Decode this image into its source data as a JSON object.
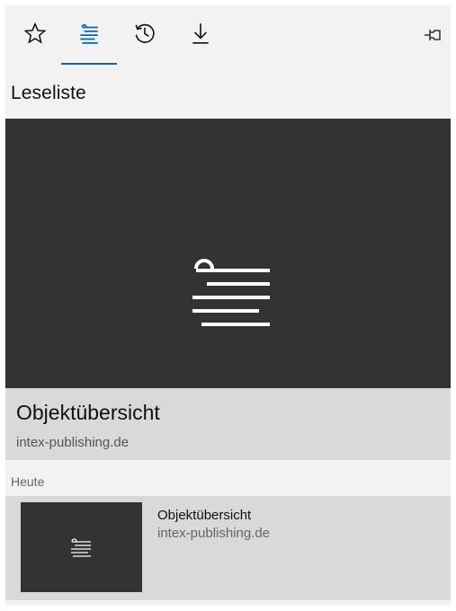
{
  "toolbar": {
    "tabs": [
      {
        "icon": "star-icon",
        "active": false
      },
      {
        "icon": "reading-list-icon",
        "active": true
      },
      {
        "icon": "history-icon",
        "active": false
      },
      {
        "icon": "download-icon",
        "active": false
      }
    ],
    "pin_icon": "pin-icon"
  },
  "section": {
    "title": "Leseliste"
  },
  "featured": {
    "title": "Objektübersicht",
    "domain": "intex-publishing.de",
    "placeholder_icon": "reading-list-icon"
  },
  "groups": [
    {
      "label": "Heute",
      "items": [
        {
          "title": "Objektübersicht",
          "domain": "intex-publishing.de",
          "thumbnail_icon": "reading-list-icon"
        }
      ]
    }
  ],
  "colors": {
    "accent": "#0067b8",
    "panel_bg": "#f2f2f2",
    "thumbnail_bg": "#333333",
    "selected_bg": "#d9d9d9"
  }
}
